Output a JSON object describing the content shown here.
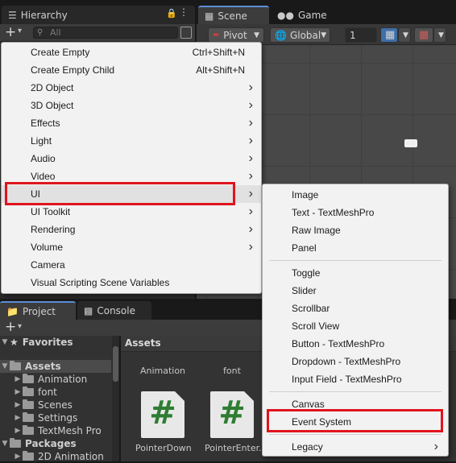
{
  "top_tabs": {
    "hierarchy": "Hierarchy",
    "scene": "Scene",
    "game": "Game"
  },
  "hierarchy": {
    "search_placeholder": "All",
    "add_label": "+",
    "dropdown_arrow": "▾"
  },
  "scene_toolbar": {
    "pivot": "Pivot",
    "global": "Global",
    "step_value": "1"
  },
  "bottom_tabs": {
    "project": "Project",
    "console": "Console"
  },
  "project": {
    "add_label": "+",
    "tree": [
      {
        "label": "Favorites",
        "level": 0,
        "icon": "star-icon"
      },
      {
        "label": "Assets",
        "level": 0,
        "icon": "folder-icon"
      },
      {
        "label": "Animation",
        "level": 1,
        "icon": "folder-icon"
      },
      {
        "label": "font",
        "level": 1,
        "icon": "folder-icon"
      },
      {
        "label": "Scenes",
        "level": 1,
        "icon": "folder-icon"
      },
      {
        "label": "Settings",
        "level": 1,
        "icon": "folder-icon"
      },
      {
        "label": "TextMesh Pro",
        "level": 1,
        "icon": "folder-icon"
      },
      {
        "label": "Packages",
        "level": 0,
        "icon": "folder-icon"
      },
      {
        "label": "2D Animation",
        "level": 1,
        "icon": "folder-icon"
      }
    ],
    "assets_header": "Assets",
    "asset_labels": [
      "Animation",
      "font"
    ],
    "script_labels": [
      "PointerDown...",
      "PointerEnter..."
    ],
    "script_glyph": "#"
  },
  "create_menu": {
    "items": [
      {
        "label": "Create Empty",
        "shortcut": "Ctrl+Shift+N",
        "submenu": false
      },
      {
        "label": "Create Empty Child",
        "shortcut": "Alt+Shift+N",
        "submenu": false
      },
      {
        "label": "2D Object",
        "shortcut": "",
        "submenu": true
      },
      {
        "label": "3D Object",
        "shortcut": "",
        "submenu": true
      },
      {
        "label": "Effects",
        "shortcut": "",
        "submenu": true
      },
      {
        "label": "Light",
        "shortcut": "",
        "submenu": true
      },
      {
        "label": "Audio",
        "shortcut": "",
        "submenu": true
      },
      {
        "label": "Video",
        "shortcut": "",
        "submenu": true
      },
      {
        "label": "UI",
        "shortcut": "",
        "submenu": true
      },
      {
        "label": "UI Toolkit",
        "shortcut": "",
        "submenu": true
      },
      {
        "label": "Rendering",
        "shortcut": "",
        "submenu": true
      },
      {
        "label": "Volume",
        "shortcut": "",
        "submenu": true
      },
      {
        "label": "Camera",
        "shortcut": "",
        "submenu": false
      },
      {
        "label": "Visual Scripting Scene Variables",
        "shortcut": "",
        "submenu": false
      }
    ],
    "arrow_glyph": "›"
  },
  "ui_submenu": {
    "groups": [
      [
        "Image",
        "Text - TextMeshPro",
        "Raw Image",
        "Panel"
      ],
      [
        "Toggle",
        "Slider",
        "Scrollbar",
        "Scroll View",
        "Button - TextMeshPro",
        "Dropdown - TextMeshPro",
        "Input Field - TextMeshPro"
      ],
      [
        "Canvas",
        "Event System"
      ],
      [
        "Legacy"
      ]
    ]
  },
  "colors": {
    "highlight": "#e0141e",
    "accent": "#3e6ea8"
  }
}
